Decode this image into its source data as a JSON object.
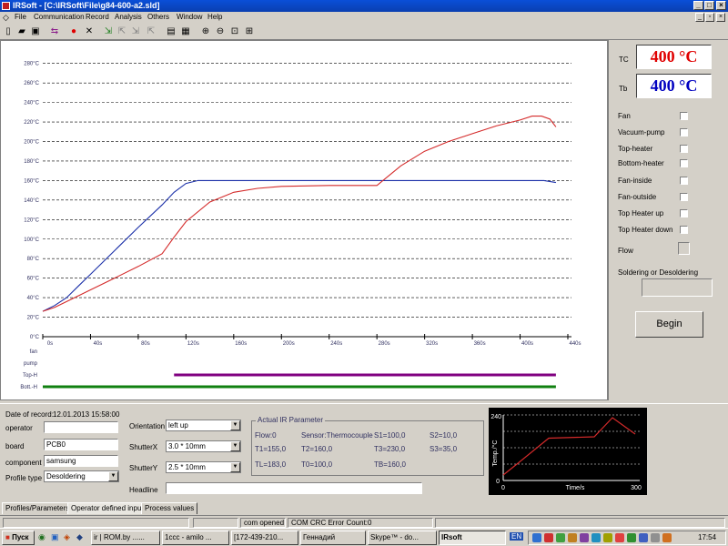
{
  "window": {
    "title": "IRSoft - [C:\\IRSoft\\File\\g84-600-a2.sld]"
  },
  "menu": [
    "File",
    "Communication",
    "Record",
    "Analysis",
    "Others",
    "Window",
    "Help"
  ],
  "chart_data": [
    {
      "type": "line",
      "title": "",
      "xlabel": "",
      "ylabel": "",
      "x_ticks": [
        "0s",
        "40s",
        "80s",
        "120s",
        "160s",
        "200s",
        "240s",
        "280s",
        "320s",
        "360s",
        "400s",
        "440s"
      ],
      "y_ticks": [
        "0°C",
        "20°C",
        "40°C",
        "60°C",
        "80°C",
        "100°C",
        "120°C",
        "140°C",
        "160°C",
        "180°C",
        "200°C",
        "220°C",
        "240°C",
        "260°C",
        "280°C"
      ],
      "xlim": [
        0,
        440
      ],
      "ylim": [
        0,
        290
      ],
      "grid": true,
      "series": [
        {
          "name": "",
          "color": "#1a2fa8",
          "x": [
            0,
            10,
            20,
            30,
            40,
            60,
            80,
            100,
            110,
            120,
            130,
            140,
            160,
            200,
            240,
            280,
            320,
            360,
            400,
            420,
            430
          ],
          "y": [
            26,
            32,
            40,
            52,
            64,
            88,
            112,
            135,
            148,
            157,
            160,
            160,
            160,
            160,
            160,
            160,
            160,
            160,
            160,
            160,
            158
          ]
        },
        {
          "name": "",
          "color": "#d42a2a",
          "x": [
            0,
            10,
            20,
            40,
            60,
            80,
            100,
            110,
            120,
            140,
            160,
            180,
            200,
            240,
            280,
            290,
            300,
            320,
            340,
            360,
            380,
            400,
            410,
            418,
            425,
            430
          ],
          "y": [
            26,
            30,
            36,
            48,
            60,
            72,
            85,
            102,
            118,
            138,
            148,
            152,
            154,
            155,
            155,
            165,
            175,
            190,
            200,
            208,
            216,
            222,
            226,
            226,
            223,
            215
          ]
        }
      ]
    },
    {
      "type": "line",
      "title": "",
      "xlabel": "Time/s",
      "ylabel": "Temp./°C",
      "x_ticks": [
        "0",
        "300"
      ],
      "y_ticks": [
        "0",
        "240"
      ],
      "xlim": [
        0,
        300
      ],
      "ylim": [
        0,
        240
      ],
      "grid": true,
      "series": [
        {
          "name": "",
          "color": "#d42a2a",
          "x": [
            0,
            30,
            100,
            200,
            240,
            290
          ],
          "y": [
            20,
            60,
            155,
            160,
            230,
            170
          ]
        }
      ]
    }
  ],
  "channels": [
    "fan",
    "pump",
    "Top-H",
    "Bott.-H"
  ],
  "channel_bars": [
    {
      "label": "Top-H",
      "color": "#800080",
      "start": 110,
      "end": 430
    },
    {
      "label": "Bott.-H",
      "color": "#108010",
      "start": 0,
      "end": 430
    }
  ],
  "right_panel": {
    "tc_label": "TC",
    "tc_value": "400 °C",
    "tc_color": "#e00000",
    "tb_label": "Tb",
    "tb_value": "400 °C",
    "tb_color": "#0000c0",
    "checks": [
      "Fan",
      "Vacuum-pump",
      "Top-heater",
      "Bottom-heater",
      "Fan-inside",
      "Fan-outside",
      "Top Heater up",
      "Top Heater down"
    ],
    "flow_label": "Flow",
    "soldering_label": "Soldering or Desoldering",
    "begin_label": "Begin"
  },
  "record": {
    "date_label": "Date of record:",
    "date_value": "12.01.2013 15:58:00",
    "operator_label": "operator",
    "operator_value": "",
    "board_label": "board",
    "board_value": "PCB0",
    "component_label": "component",
    "component_value": "samsung",
    "profile_label": "Profile type",
    "profile_value": "Desoldering",
    "orientation_label": "Orientation",
    "orientation_value": "left up",
    "shutterx_label": "ShutterX",
    "shutterx_value": "3.0 * 10mm",
    "shuttery_label": "ShutterY",
    "shuttery_value": "2.5 * 10mm",
    "headline_label": "Headline",
    "headline_value": ""
  },
  "ir": {
    "title": "Actual IR Parameter",
    "flow": "Flow:0",
    "sensor": "Sensor:Thermocouple",
    "s1": "S1=100,0",
    "s2": "S2=10,0",
    "t1": "T1=155,0",
    "t2": "T2=160,0",
    "t3": "T3=230,0",
    "s3": "S3=35,0",
    "tl": "TL=183,0",
    "t0": "T0=100,0",
    "tb": "TB=160,0"
  },
  "tabs": [
    "Profiles/Parameters",
    "Operator defined input",
    "Process values"
  ],
  "status": {
    "com": "com opened",
    "crc": "COM CRC Error Count:0"
  },
  "taskbar": {
    "start": "Пуск",
    "tasks": [
      "ir | ROM.by ......",
      "1ccc - amilo ...",
      "[172-439-210...",
      "Геннадий",
      "Skype™ - do...",
      "IRsoft"
    ],
    "lang": "EN",
    "clock": "17:54"
  }
}
